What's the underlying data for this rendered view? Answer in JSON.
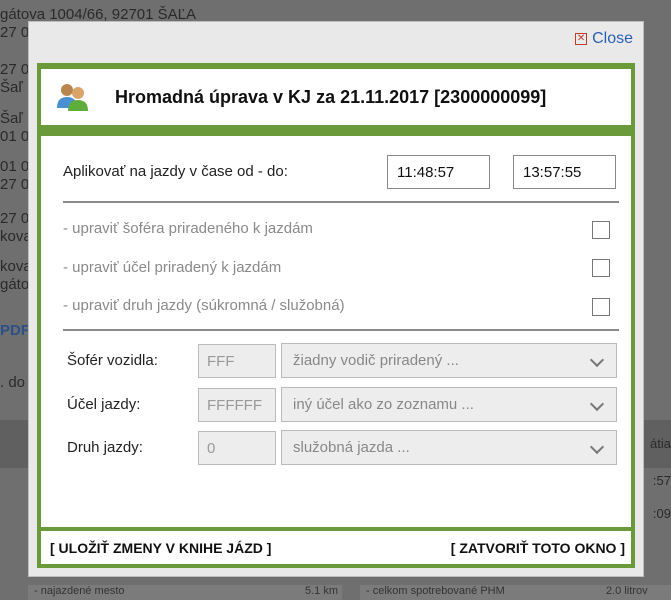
{
  "background": {
    "lines": [
      "gátova 1004/66, 92701 ŠAĽA",
      "27 0",
      "27 0",
      "Šaľ",
      "Šaľ",
      "01 0",
      "01 0",
      "27 0",
      "27 0",
      "kova",
      "kova",
      "gáto",
      "PDF",
      ". do"
    ],
    "right_text": [
      "átia",
      ":57",
      ":09"
    ],
    "footer_left": "- najazdené mesto",
    "footer_left_value": "5.1 km",
    "footer_right": "- celkom spotrebované PHM",
    "footer_right_value": "2.0 litrov"
  },
  "dialog": {
    "close_label": "Close",
    "title": "Hromadná úprava v KJ za 21.11.2017 [2300000099]",
    "apply_label": "Aplikovať na jazdy v čase od - do:",
    "time_from": "11:48:57",
    "time_to": "13:57:55",
    "options": [
      {
        "label": "- upraviť šoféra priradeného k jazdám"
      },
      {
        "label": "- upraviť účel priradený k jazdám"
      },
      {
        "label": "- upraviť druh jazdy (súkromná / služobná)"
      }
    ],
    "fields": {
      "driver": {
        "label": "Šofér vozidla:",
        "code": "FFF",
        "select": "žiadny vodič priradený ..."
      },
      "purpose": {
        "label": "Účel jazdy:",
        "code": "FFFFFF",
        "select": "iný účel ako zo zoznamu ..."
      },
      "type": {
        "label": "Druh jazdy:",
        "code": "0",
        "select": "služobná jazda ..."
      }
    },
    "save_label": "[ ULOŽIŤ ZMENY V KNIHE JÁZD ]",
    "close_window_label": "[ ZATVORIŤ TOTO OKNO ]"
  },
  "colors": {
    "accent_green": "#6a9a3a",
    "link_blue": "#2b5fb4",
    "overlay": "#6f6f6f"
  }
}
